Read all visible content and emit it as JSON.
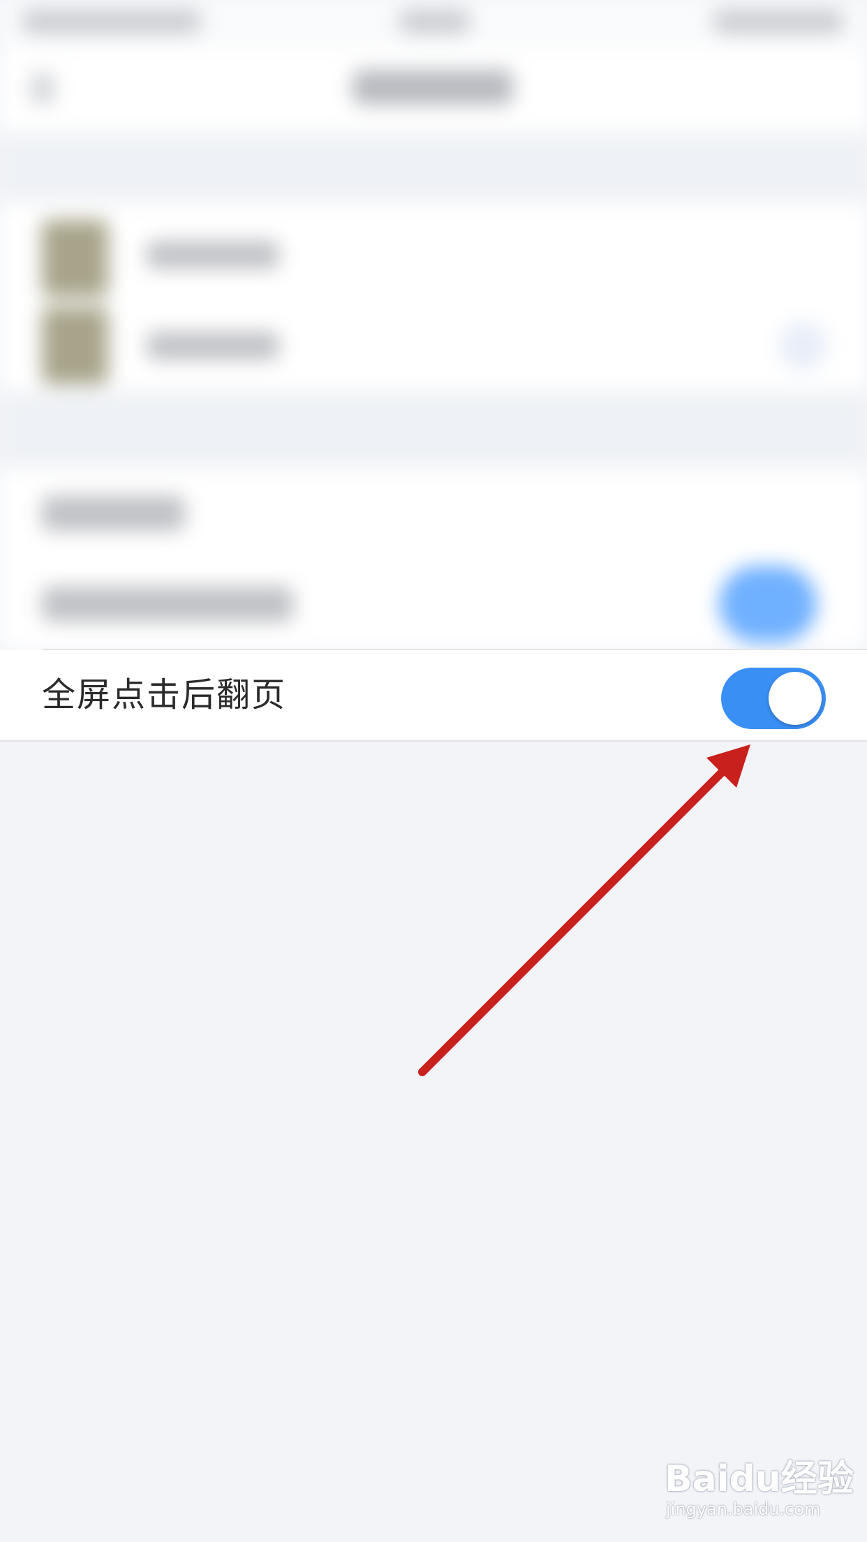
{
  "setting": {
    "label": "全屏点击后翻页",
    "enabled": true
  },
  "colors": {
    "toggle_on": "#3a8ff5",
    "arrow": "#c8201c",
    "background": "#f2f4f8"
  },
  "watermark": {
    "brand": "Baidu经验",
    "url": "jingyan.baidu.com"
  }
}
